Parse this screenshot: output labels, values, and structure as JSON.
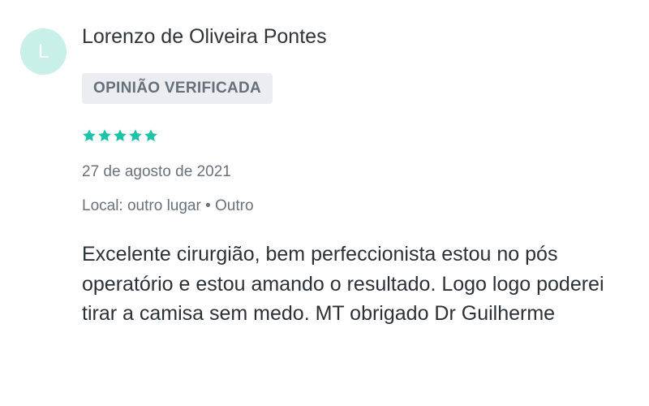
{
  "review": {
    "avatar_letter": "L",
    "author_name": "Lorenzo de Oliveira Pontes",
    "badge_label": "OPINIÃO VERIFICADA",
    "rating": 5,
    "rating_max": 5,
    "date": "27 de agosto de 2021",
    "location": "Local: outro lugar • Outro",
    "body": "Excelente cirurgião, bem perfeccionista estou no pós operatório e estou amando o resultado. Logo logo poderei tirar a camisa sem medo. MT obrigado Dr Guilherme"
  },
  "colors": {
    "avatar_bg": "#c8efe8",
    "star": "#1ec3a7",
    "badge_bg": "#ebedf0",
    "badge_text": "#65707a"
  },
  "icons": {
    "star": "star-icon"
  }
}
